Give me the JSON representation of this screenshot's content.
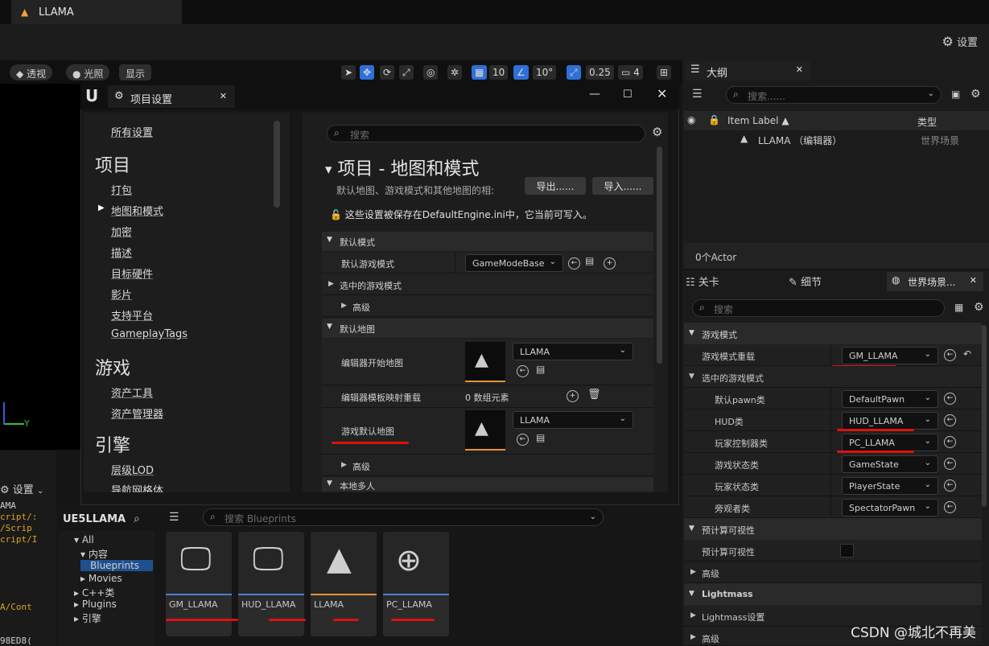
{
  "app": {
    "tab_title": "LLAMA",
    "settings_label": "设置"
  },
  "viewport_toolbar": {
    "perspective": "透视",
    "lighting": "光照",
    "show": "显示",
    "grid_value": "10",
    "angle_value": "10°",
    "scale_value": "0.25",
    "camera_value": "4"
  },
  "project_settings": {
    "window_title": "项目设置",
    "sidebar": {
      "all_settings": "所有设置",
      "project_heading": "项目",
      "project_items": [
        "打包",
        "地图和模式",
        "加密",
        "描述",
        "目标硬件",
        "影片",
        "支持平台",
        "GameplayTags"
      ],
      "game_heading": "游戏",
      "game_items": [
        "资产工具",
        "资产管理器"
      ],
      "engine_heading": "引擎",
      "engine_items": [
        "层级LOD",
        "导航网格体"
      ]
    },
    "search_placeholder": "搜索",
    "page_title": "项目 - 地图和模式",
    "page_desc": "默认地图、游戏模式和其他地图的相:",
    "export_label": "导出......",
    "import_label": "导入......",
    "save_note": "这些设置被保存在DefaultEngine.ini中，它当前可写入。",
    "sections": {
      "default_modes": "默认模式",
      "default_game_mode_label": "默认游戏模式",
      "default_game_mode_value": "GameModeBase",
      "selected_game_mode": "选中的游戏模式",
      "advanced": "高级",
      "default_maps": "默认地图",
      "editor_start_map": "编辑器开始地图",
      "editor_start_map_value": "LLAMA",
      "editor_template_override": "编辑器模板映射重载",
      "array_elements": "0 数组元素",
      "game_default_map": "游戏默认地图",
      "game_default_map_value": "LLAMA",
      "advanced2": "高级",
      "local_multiplayer": "本地多人"
    }
  },
  "outliner": {
    "tab": "大纲",
    "search_placeholder": "搜索......",
    "col_label": "Item Label ▲",
    "col_type": "类型",
    "row_name": "LLAMA （编辑器）",
    "row_type": "世界场景",
    "actor_count": "0个Actor"
  },
  "details": {
    "tabs": [
      "关卡",
      "细节",
      "世界场景..."
    ],
    "search_placeholder": "搜索",
    "game_mode_cat": "游戏模式",
    "game_mode_override": "游戏模式重载",
    "game_mode_override_value": "GM_LLAMA",
    "selected_game_mode": "选中的游戏模式",
    "props": [
      {
        "label": "默认pawn类",
        "value": "DefaultPawn"
      },
      {
        "label": "HUD类",
        "value": "HUD_LLAMA"
      },
      {
        "label": "玩家控制器类",
        "value": "PC_LLAMA"
      },
      {
        "label": "游戏状态类",
        "value": "GameState"
      },
      {
        "label": "玩家状态类",
        "value": "PlayerState"
      },
      {
        "label": "旁观者类",
        "value": "SpectatorPawn"
      }
    ],
    "precomputed_cat": "预计算可视性",
    "precomputed_label": "预计算可视性",
    "advanced": "高级",
    "lightmass_cat": "Lightmass",
    "lightmass_settings": "Lightmass设置",
    "advanced2": "高级"
  },
  "left_panel": {
    "settings_label": "设置",
    "lines": [
      "AMA",
      "cript/:",
      "/Scrip",
      "cript/I",
      "A/Cont",
      "98ED8("
    ]
  },
  "content_browser": {
    "root": "UE5LLAMA",
    "search_placeholder": "搜索 Blueprints",
    "tree": [
      "All",
      "内容",
      "Blueprints",
      "Movies",
      "C++类",
      "Plugins",
      "引擎"
    ],
    "assets": [
      {
        "name": "GM_LLAMA",
        "color": "#4a7fd8",
        "icon": "gamepad-monitor-icon"
      },
      {
        "name": "HUD_LLAMA",
        "color": "#4a7fd8",
        "icon": "hud-monitor-icon"
      },
      {
        "name": "LLAMA",
        "color": "#e8923a",
        "icon": "map-icon"
      },
      {
        "name": "PC_LLAMA",
        "color": "#4a7fd8",
        "icon": "gamepad-icon"
      }
    ]
  },
  "watermark": "CSDN @城北不再美",
  "colors": {
    "accent_blue": "#2f6fd8",
    "underline_red": "#e01010",
    "map_orange": "#e8923a"
  }
}
